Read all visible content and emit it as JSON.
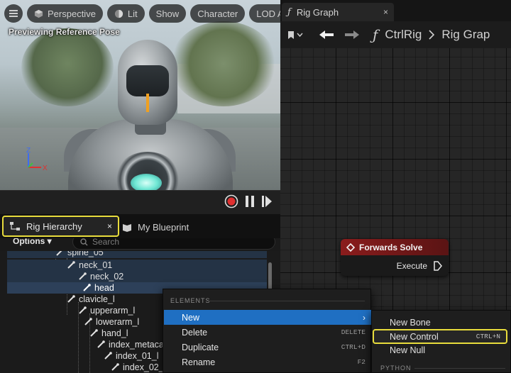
{
  "viewport": {
    "menu_icon": "hamburger-icon",
    "buttons": {
      "perspective": "Perspective",
      "lit": "Lit",
      "show": "Show",
      "character": "Character",
      "lod": "LOD Au"
    },
    "overlay": "Previewing Reference Pose",
    "axis": {
      "z": "Z",
      "x": "X"
    }
  },
  "graph": {
    "tab_title": "Rig Graph",
    "tab_close": "×",
    "breadcrumb": [
      "CtrlRig",
      "Rig Grap"
    ],
    "node": {
      "title": "Forwards Solve",
      "pin_label": "Execute"
    }
  },
  "hierarchy": {
    "tab_label": "Rig Hierarchy",
    "tab_close": "×",
    "other_tab": "My Blueprint",
    "options_label": "Options",
    "search_placeholder": "Search",
    "tree": [
      {
        "label": "spine_05",
        "indent": 4
      },
      {
        "label": "neck_01",
        "indent": 5
      },
      {
        "label": "neck_02",
        "indent": 6
      },
      {
        "label": "head",
        "indent": 7
      },
      {
        "label": "clavicle_l",
        "indent": 5
      },
      {
        "label": "upperarm_l",
        "indent": 6
      },
      {
        "label": "lowerarm_l",
        "indent": 7
      },
      {
        "label": "hand_l",
        "indent": 8
      },
      {
        "label": "index_metaca",
        "indent": 9
      },
      {
        "label": "index_01_l",
        "indent": 10
      },
      {
        "label": "index_02_",
        "indent": 11
      }
    ]
  },
  "context_menu": {
    "section": "ELEMENTS",
    "items": [
      {
        "label": "New",
        "shortcut": "",
        "submenu": true
      },
      {
        "label": "Delete",
        "shortcut": "DELETE"
      },
      {
        "label": "Duplicate",
        "shortcut": "CTRL+D"
      },
      {
        "label": "Rename",
        "shortcut": "F2"
      }
    ]
  },
  "submenu": {
    "items": [
      {
        "label": "New Bone",
        "shortcut": ""
      },
      {
        "label": "New Control",
        "shortcut": "CTRL+N"
      },
      {
        "label": "New Null",
        "shortcut": ""
      }
    ],
    "section": "PYTHON"
  },
  "colors": {
    "highlight": "#e8dc3c",
    "menu_active": "#1f6fc2",
    "node_header": "#8a1c1c",
    "record": "#e03030"
  }
}
